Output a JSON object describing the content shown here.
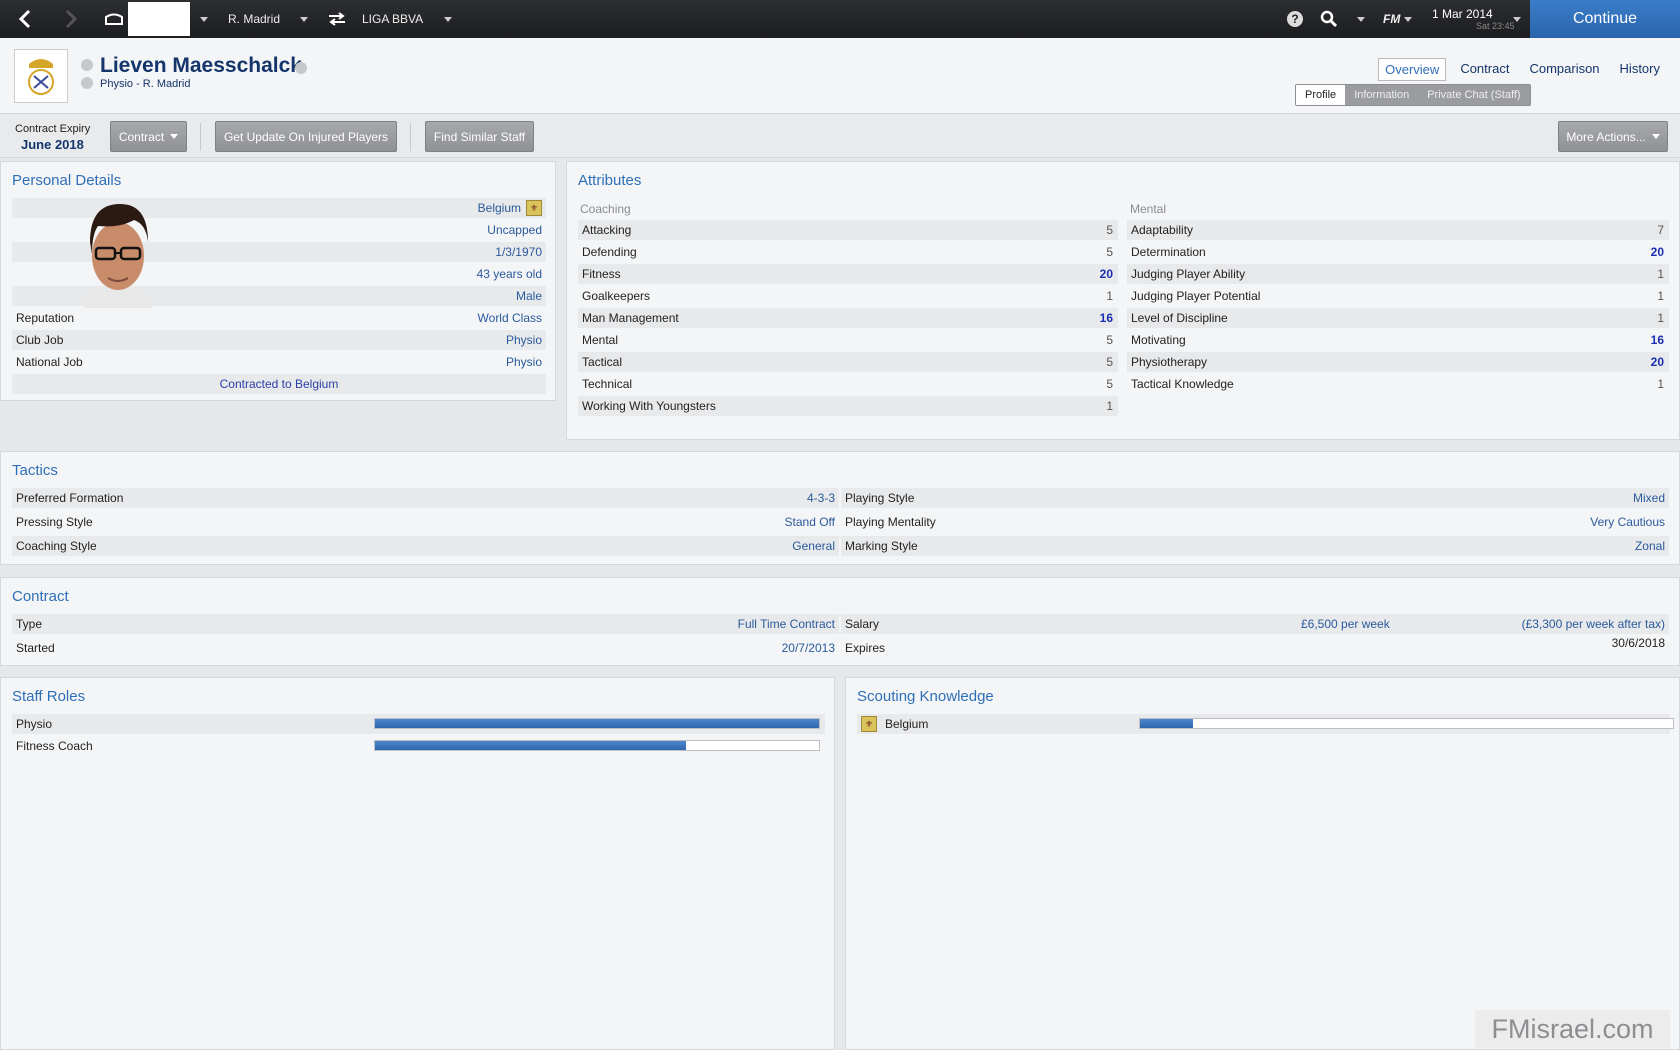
{
  "topbar": {
    "club": "R. Madrid",
    "league": "LIGA BBVA",
    "fm_logo": "FM",
    "date": "1 Mar 2014",
    "time": "Sat 23:45",
    "continue_label": "Continue",
    "icons": [
      "back-icon",
      "forward-icon",
      "stadium-icon",
      "swap-icon",
      "help-icon",
      "search-icon"
    ]
  },
  "header": {
    "name": "Lieven Maesschalck",
    "subtitle": "Physio - R. Madrid",
    "nav_tabs": [
      "Overview",
      "Contract",
      "Comparison",
      "History"
    ],
    "sub_tabs": [
      "Profile",
      "Information",
      "Private Chat (Staff)"
    ]
  },
  "actions": {
    "expiry_label": "Contract Expiry",
    "expiry_value": "June 2018",
    "contract_btn": "Contract",
    "injury_btn": "Get Update On Injured Players",
    "similar_btn": "Find Similar Staff",
    "more_btn": "More Actions..."
  },
  "personal": {
    "title": "Personal Details",
    "nationality": "Belgium",
    "caps": "Uncapped",
    "dob": "1/3/1970",
    "age": "43 years old",
    "gender": "Male",
    "rows": [
      {
        "label": "Reputation",
        "value": "World Class"
      },
      {
        "label": "Club Job",
        "value": "Physio"
      },
      {
        "label": "National Job",
        "value": "Physio"
      }
    ],
    "contracted": "Contracted to Belgium"
  },
  "attributes": {
    "title": "Attributes",
    "coaching_label": "Coaching",
    "mental_label": "Mental",
    "coaching": [
      {
        "name": "Attacking",
        "value": "5",
        "hi": false
      },
      {
        "name": "Defending",
        "value": "5",
        "hi": false
      },
      {
        "name": "Fitness",
        "value": "20",
        "hi": true
      },
      {
        "name": "Goalkeepers",
        "value": "1",
        "hi": false
      },
      {
        "name": "Man Management",
        "value": "16",
        "hi": true
      },
      {
        "name": "Mental",
        "value": "5",
        "hi": false
      },
      {
        "name": "Tactical",
        "value": "5",
        "hi": false
      },
      {
        "name": "Technical",
        "value": "5",
        "hi": false
      },
      {
        "name": "Working With Youngsters",
        "value": "1",
        "hi": false
      }
    ],
    "mental": [
      {
        "name": "Adaptability",
        "value": "7",
        "hi": false
      },
      {
        "name": "Determination",
        "value": "20",
        "hi": true
      },
      {
        "name": "Judging Player Ability",
        "value": "1",
        "hi": false
      },
      {
        "name": "Judging Player Potential",
        "value": "1",
        "hi": false
      },
      {
        "name": "Level of Discipline",
        "value": "1",
        "hi": false
      },
      {
        "name": "Motivating",
        "value": "16",
        "hi": true
      },
      {
        "name": "Physiotherapy",
        "value": "20",
        "hi": true
      },
      {
        "name": "Tactical Knowledge",
        "value": "1",
        "hi": false
      }
    ]
  },
  "tactics": {
    "title": "Tactics",
    "left": [
      {
        "label": "Preferred Formation",
        "value": "4-3-3"
      },
      {
        "label": "Pressing Style",
        "value": "Stand Off"
      },
      {
        "label": "Coaching Style",
        "value": "General"
      }
    ],
    "right": [
      {
        "label": "Playing Style",
        "value": "Mixed"
      },
      {
        "label": "Playing Mentality",
        "value": "Very Cautious"
      },
      {
        "label": "Marking Style",
        "value": "Zonal"
      }
    ]
  },
  "contract": {
    "title": "Contract",
    "type_label": "Type",
    "type_value": "Full Time Contract",
    "started_label": "Started",
    "started_value": "20/7/2013",
    "salary_label": "Salary",
    "salary_value": "£6,500 per week",
    "salary_after_tax": "(£3,300 per week after tax)",
    "expires_label": "Expires",
    "expires_value": "30/6/2018"
  },
  "staff_roles": {
    "title": "Staff Roles",
    "roles": [
      {
        "name": "Physio",
        "level": 1.0
      },
      {
        "name": "Fitness Coach",
        "level": 0.7
      }
    ]
  },
  "scouting": {
    "title": "Scouting Knowledge",
    "items": [
      {
        "name": "Belgium",
        "level": 0.1
      }
    ]
  },
  "watermark": "FMisrael.com"
}
